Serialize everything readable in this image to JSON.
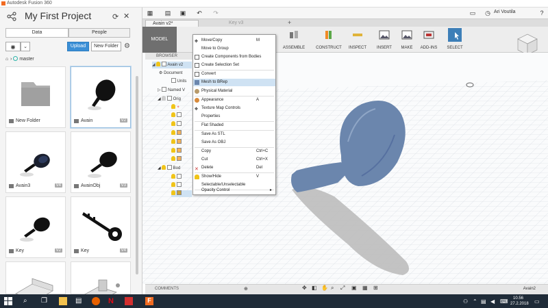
{
  "window": {
    "title": "Autodesk Fusion 360"
  },
  "project": {
    "title": "My First Project"
  },
  "panel_tabs": {
    "data": "Data",
    "people": "People"
  },
  "actions": {
    "upload": "Upload",
    "new_folder": "New Folder"
  },
  "breadcrumb": {
    "branch": "master"
  },
  "files": [
    {
      "name": "New Folder",
      "version": ""
    },
    {
      "name": "Avain",
      "version": "V2"
    },
    {
      "name": "Avain3",
      "version": "V4"
    },
    {
      "name": "AvainObj",
      "version": "V3"
    },
    {
      "name": "Key",
      "version": "V2"
    },
    {
      "name": "Key",
      "version": "V4"
    }
  ],
  "topbar": {
    "user": "Ari Voutila"
  },
  "doc_tabs": [
    {
      "label": "Avain v2*"
    },
    {
      "label": "Key v3"
    }
  ],
  "toolbar": {
    "workspace": "MODEL",
    "groups": [
      "ASSEMBLE",
      "CONSTRUCT",
      "INSPECT",
      "INSERT",
      "MAKE",
      "ADD-INS",
      "SELECT"
    ]
  },
  "browser": {
    "header": "BROWSER",
    "rows": [
      "Avain v2",
      "Document",
      "Units",
      "Named V",
      "Orig",
      "Bod"
    ]
  },
  "context_menu": {
    "items": [
      {
        "label": "Move/Copy",
        "shortcut": "M"
      },
      {
        "label": "Move to Group",
        "shortcut": ""
      },
      {
        "label": "Create Components from Bodies",
        "shortcut": ""
      },
      {
        "label": "Create Selection Set",
        "shortcut": ""
      },
      {
        "label": "Convert",
        "shortcut": ""
      },
      {
        "label": "Mesh to BRep",
        "shortcut": ""
      },
      {
        "label": "Physical Material",
        "shortcut": ""
      },
      {
        "label": "Appearance",
        "shortcut": "A"
      },
      {
        "label": "Texture Map Controls",
        "shortcut": ""
      },
      {
        "label": "Properties",
        "shortcut": ""
      },
      {
        "label": "Flat Shaded",
        "shortcut": ""
      },
      {
        "label": "Save As STL",
        "shortcut": ""
      },
      {
        "label": "Save As OBJ",
        "shortcut": ""
      },
      {
        "label": "Copy",
        "shortcut": "Ctrl+C"
      },
      {
        "label": "Cut",
        "shortcut": "Ctrl+X"
      },
      {
        "label": "Delete",
        "shortcut": "Del"
      },
      {
        "label": "Show/Hide",
        "shortcut": "V"
      },
      {
        "label": "Selectable/Unselectable",
        "shortcut": ""
      },
      {
        "label": "Opacity Control",
        "shortcut": ""
      }
    ],
    "highlighted": 5
  },
  "comments": {
    "label": "COMMENTS",
    "doc_name": "Avain2"
  },
  "taskbar": {
    "time": "10.56",
    "date": "27.2.2018"
  },
  "colors": {
    "accent": "#3b8fd6",
    "mesh": "#6b86ad",
    "highlight": "#cfe2f3"
  }
}
